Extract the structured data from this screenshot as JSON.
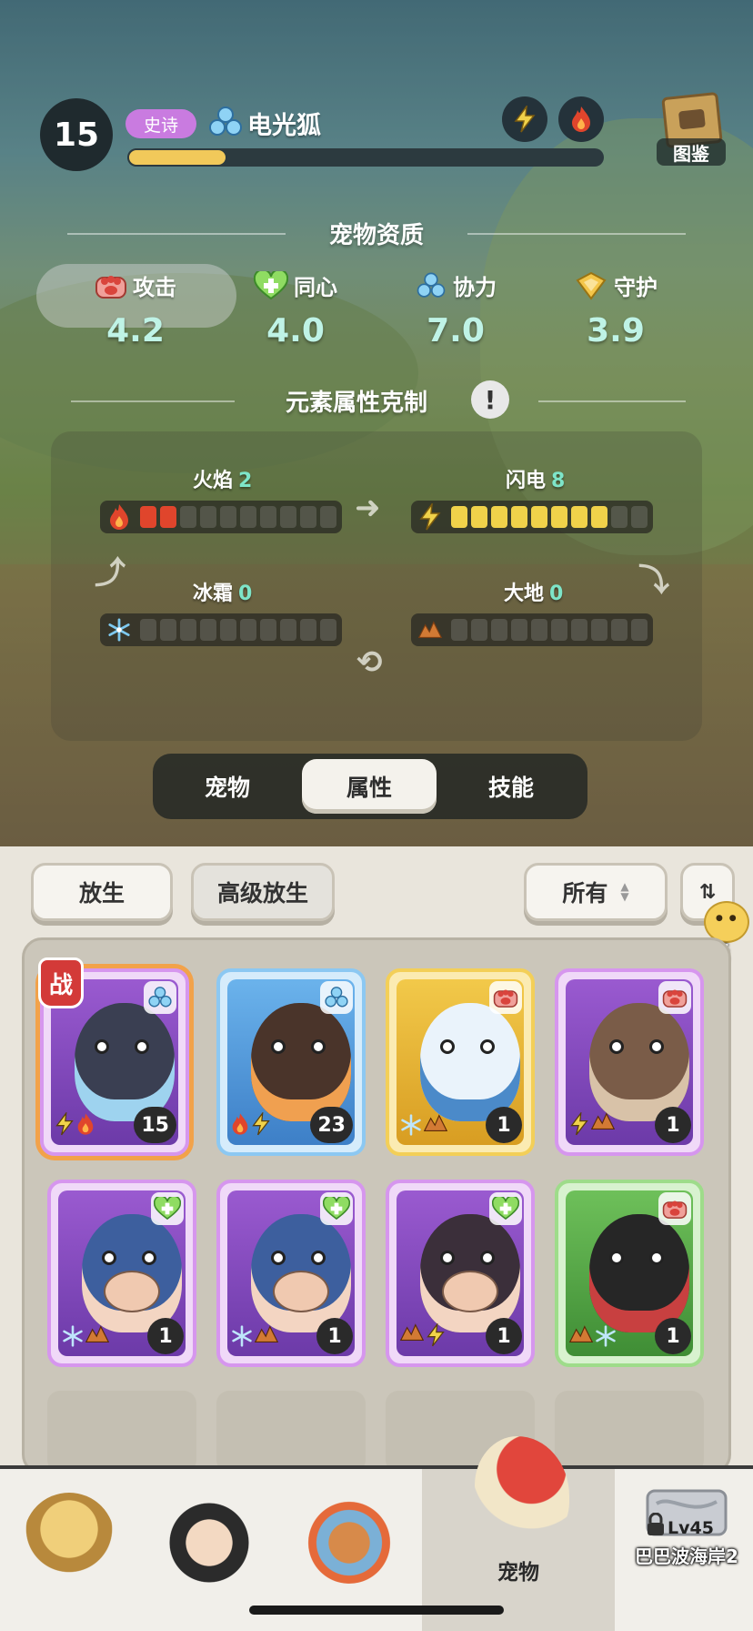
{
  "colors": {
    "rarity_epic": "#c97be0",
    "exp_fill": "#f1c95a",
    "stat_value": "#bff3e6",
    "fire": "#e0452c",
    "lightning": "#f0d24a",
    "ice": "#7ec9ef",
    "earth": "#d27a34"
  },
  "pet": {
    "level": "15",
    "rarity": "史诗",
    "name": "电光狐",
    "exp_progress": 0.21,
    "element_icons": [
      "lightning-icon",
      "fire-icon"
    ]
  },
  "codex": {
    "label": "图鉴"
  },
  "aptitude": {
    "title": "宠物资质",
    "stats": [
      {
        "label": "攻击",
        "value": "4.2",
        "icon": "attack-paw-icon"
      },
      {
        "label": "同心",
        "value": "4.0",
        "icon": "heart-plus-icon"
      },
      {
        "label": "协力",
        "value": "7.0",
        "icon": "team-icon"
      },
      {
        "label": "守护",
        "value": "3.9",
        "icon": "shield-icon"
      }
    ]
  },
  "elements": {
    "title": "元素属性克制",
    "max_level": 10,
    "items": [
      {
        "label": "火焰",
        "value": "2",
        "level": 2,
        "icon": "fire-icon"
      },
      {
        "label": "闪电",
        "value": "8",
        "level": 8,
        "icon": "lightning-icon"
      },
      {
        "label": "冰霜",
        "value": "0",
        "level": 0,
        "icon": "ice-icon"
      },
      {
        "label": "大地",
        "value": "0",
        "level": 0,
        "icon": "earth-icon"
      }
    ]
  },
  "tabs": [
    {
      "label": "宠物",
      "active": false
    },
    {
      "label": "属性",
      "active": true
    },
    {
      "label": "技能",
      "active": false
    }
  ],
  "inventory": {
    "release": "放生",
    "advanced_release": "高级放生",
    "filter": "所有",
    "chat": "聊天",
    "battle_tag": "战",
    "cards": [
      {
        "count": "15",
        "frame": "purple",
        "type": "team-icon",
        "elements": [
          "lightning-icon",
          "fire-icon"
        ],
        "in_battle": true
      },
      {
        "count": "23",
        "frame": "blue",
        "type": "team-icon",
        "elements": [
          "fire-icon",
          "lightning-icon"
        ]
      },
      {
        "count": "1",
        "frame": "gold",
        "type": "attack-paw-icon",
        "elements": [
          "ice-icon",
          "earth-icon"
        ]
      },
      {
        "count": "1",
        "frame": "purple",
        "type": "attack-paw-icon",
        "elements": [
          "lightning-icon",
          "earth-icon"
        ]
      },
      {
        "count": "1",
        "frame": "purple",
        "type": "heart-plus-icon",
        "elements": [
          "ice-icon",
          "earth-icon"
        ]
      },
      {
        "count": "1",
        "frame": "purple",
        "type": "heart-plus-icon",
        "elements": [
          "ice-icon",
          "earth-icon"
        ]
      },
      {
        "count": "1",
        "frame": "purple",
        "type": "heart-plus-icon",
        "elements": [
          "earth-icon",
          "lightning-icon"
        ]
      },
      {
        "count": "1",
        "frame": "green",
        "type": "attack-paw-icon",
        "elements": [
          "earth-icon",
          "ice-icon"
        ]
      }
    ]
  },
  "nav": {
    "items": [
      {
        "label": "",
        "icon": "hero-caveman-icon"
      },
      {
        "label": "",
        "icon": "hero-warrior-icon"
      },
      {
        "label": "",
        "icon": "hero-totem-icon"
      },
      {
        "label": "宠物",
        "icon": "pet-dino-icon",
        "active": true
      }
    ],
    "locked": {
      "level": "Lv45",
      "name": "巴巴波海岸2"
    }
  }
}
